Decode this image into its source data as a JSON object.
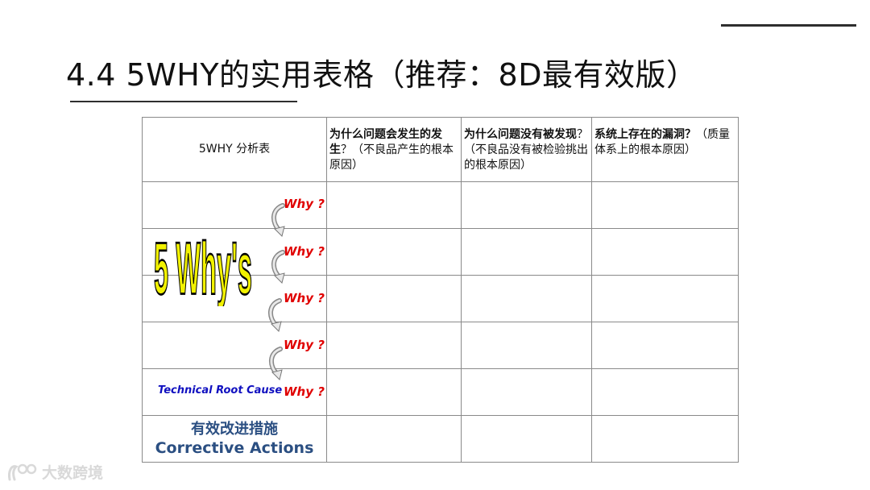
{
  "slide": {
    "title": "4.4 5WHY的实用表格（推荐：8D最有效版）"
  },
  "table": {
    "header": {
      "col1": "5WHY 分析表",
      "col2_bold": "为什么问题会发生的发生",
      "col2_rest": "？（不良品产生的根本原因）",
      "col3_bold": "为什么问题没有被发现",
      "col3_rest": "？（不良品没有被检验挑出的根本原因）",
      "col4_bold": "系统上存在的漏洞？",
      "col4_rest": "（质量体系上的根本原因）"
    },
    "why_label": "Why ?",
    "technical_root_cause": "Technical Root Cause",
    "five_whys_text": "5 Why's",
    "last_row_cn": "有效改进措施",
    "last_row_en": "Corrective Actions"
  },
  "watermark": {
    "text": "大数跨境"
  },
  "colors": {
    "why_red": "#e00000",
    "root_cause_blue": "#1010c0",
    "actions_navy": "#2b4f82",
    "five_whys_yellow": "#f2f200"
  }
}
